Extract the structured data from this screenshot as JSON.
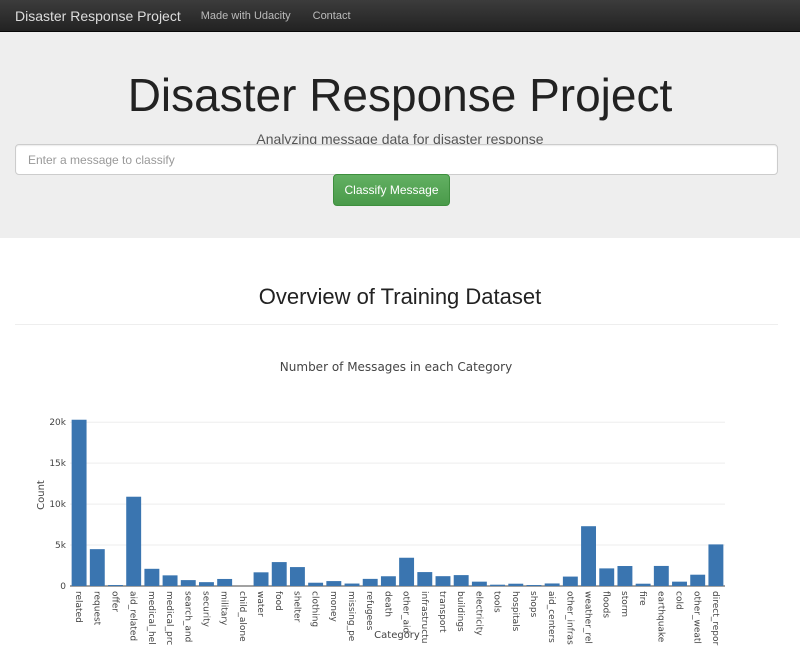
{
  "navbar": {
    "brand": "Disaster Response Project",
    "links": [
      "Made with Udacity",
      "Contact"
    ]
  },
  "jumbotron": {
    "title": "Disaster Response Project",
    "subtitle": "Analyzing message data for disaster response",
    "input_placeholder": "Enter a message to classify",
    "button_label": "Classify Message"
  },
  "section": {
    "title": "Overview of Training Dataset"
  },
  "colors": {
    "bar": "#3a75b0",
    "button": "#5cb85c",
    "navbar": "#222222"
  },
  "chart_data": {
    "type": "bar",
    "title": "Number of Messages in each Category",
    "xlabel": "Category",
    "ylabel": "Count",
    "ylim": [
      0,
      21000
    ],
    "yticks": [
      0,
      5000,
      10000,
      15000,
      20000
    ],
    "ytick_labels": [
      "0",
      "5k",
      "10k",
      "15k",
      "20k"
    ],
    "grid": true,
    "categories": [
      "related",
      "request",
      "offer",
      "aid_related",
      "medical_hel",
      "medical_prc",
      "search_and",
      "security",
      "military",
      "child_alone",
      "water",
      "food",
      "shelter",
      "clothing",
      "money",
      "missing_pe",
      "refugees",
      "death",
      "other_aid",
      "infrastructu",
      "transport",
      "buildings",
      "electricity",
      "tools",
      "hospitals",
      "shops",
      "aid_centers",
      "other_infras",
      "weather_rel",
      "floods",
      "storm",
      "fire",
      "earthquake",
      "cold",
      "other_weatl",
      "direct_repor"
    ],
    "values": [
      20300,
      4500,
      120,
      10900,
      2100,
      1300,
      720,
      470,
      860,
      0,
      1670,
      2920,
      2310,
      400,
      600,
      300,
      870,
      1190,
      3450,
      1700,
      1200,
      1330,
      530,
      160,
      280,
      120,
      310,
      1150,
      7300,
      2150,
      2440,
      280,
      2450,
      530,
      1380,
      5080
    ]
  }
}
